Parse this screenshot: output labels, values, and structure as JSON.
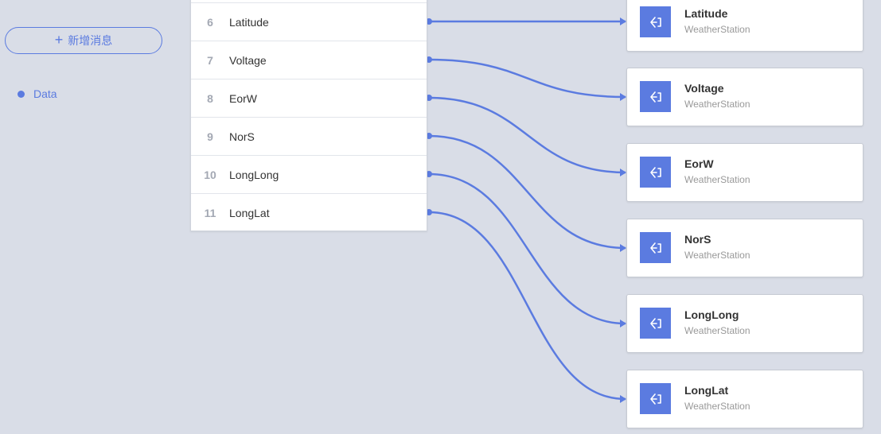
{
  "sidebar": {
    "add_button_icon": "+",
    "add_button_label": "新增消息",
    "messages": [
      {
        "label": "Data"
      }
    ]
  },
  "fields": [
    {
      "index": "6",
      "name": "Latitude"
    },
    {
      "index": "7",
      "name": "Voltage"
    },
    {
      "index": "8",
      "name": "EorW"
    },
    {
      "index": "9",
      "name": "NorS"
    },
    {
      "index": "10",
      "name": "LongLong"
    },
    {
      "index": "11",
      "name": "LongLat"
    }
  ],
  "targets": [
    {
      "title": "Latitude",
      "subtitle": "WeatherStation",
      "icon": "input-arrow-icon"
    },
    {
      "title": "Voltage",
      "subtitle": "WeatherStation",
      "icon": "input-arrow-icon"
    },
    {
      "title": "EorW",
      "subtitle": "WeatherStation",
      "icon": "input-arrow-icon"
    },
    {
      "title": "NorS",
      "subtitle": "WeatherStation",
      "icon": "input-arrow-icon"
    },
    {
      "title": "LongLong",
      "subtitle": "WeatherStation",
      "icon": "input-arrow-icon"
    },
    {
      "title": "LongLat",
      "subtitle": "WeatherStation",
      "icon": "input-arrow-icon"
    }
  ],
  "mappings": [
    {
      "from": "Latitude",
      "to": "Latitude"
    },
    {
      "from": "Voltage",
      "to": "Voltage"
    },
    {
      "from": "EorW",
      "to": "EorW"
    },
    {
      "from": "NorS",
      "to": "NorS"
    },
    {
      "from": "LongLong",
      "to": "LongLong"
    },
    {
      "from": "LongLat",
      "to": "LongLat"
    }
  ],
  "colors": {
    "accent": "#5b7be0",
    "background": "#d9dde7"
  }
}
